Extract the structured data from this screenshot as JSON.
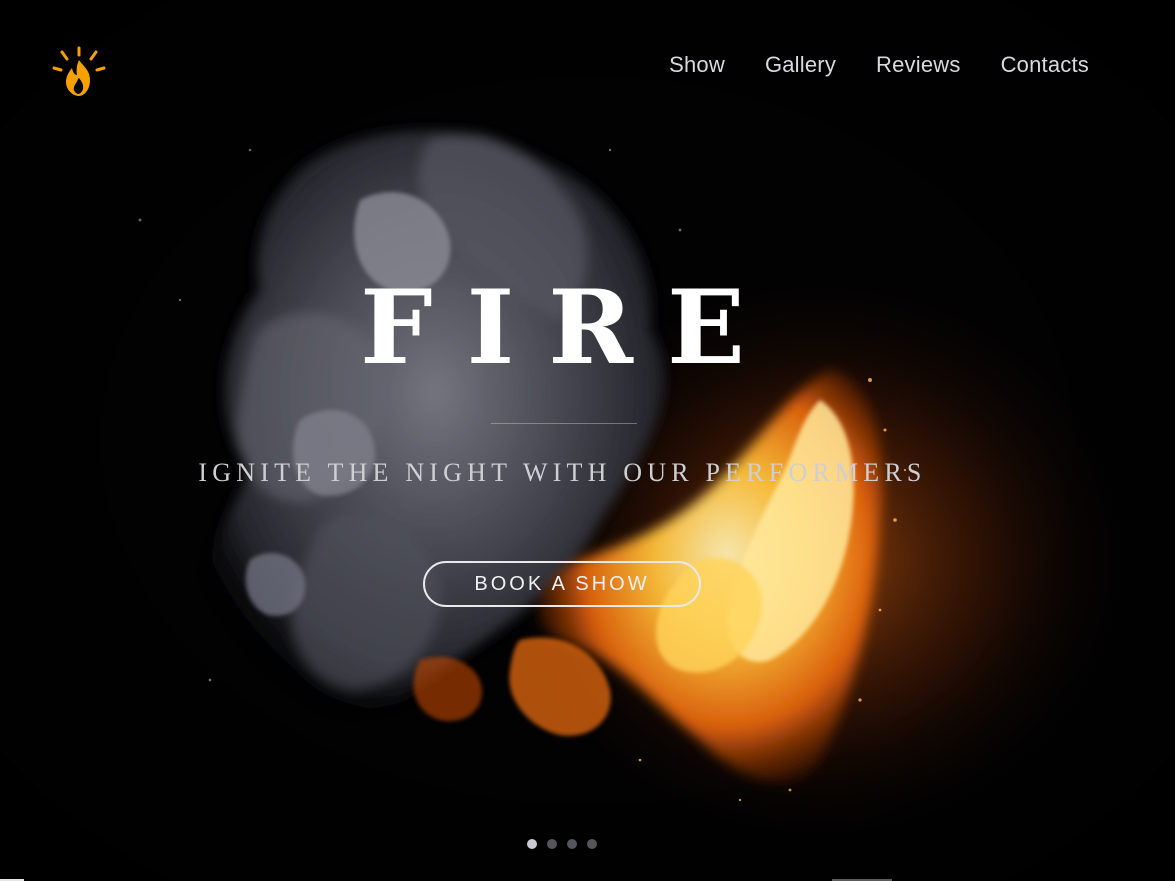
{
  "brand": {
    "logo_icon": "fire-icon",
    "accent_color": "#f5a100"
  },
  "nav": {
    "items": [
      {
        "label": "Show"
      },
      {
        "label": "Gallery"
      },
      {
        "label": "Reviews"
      },
      {
        "label": "Contacts"
      }
    ]
  },
  "hero": {
    "title": "FIRE",
    "subtitle": "IGNITE THE NIGHT WITH OUR PERFORMERS",
    "cta_label": "BOOK A SHOW"
  },
  "slider": {
    "slide_count": 4,
    "active_index": 0
  }
}
